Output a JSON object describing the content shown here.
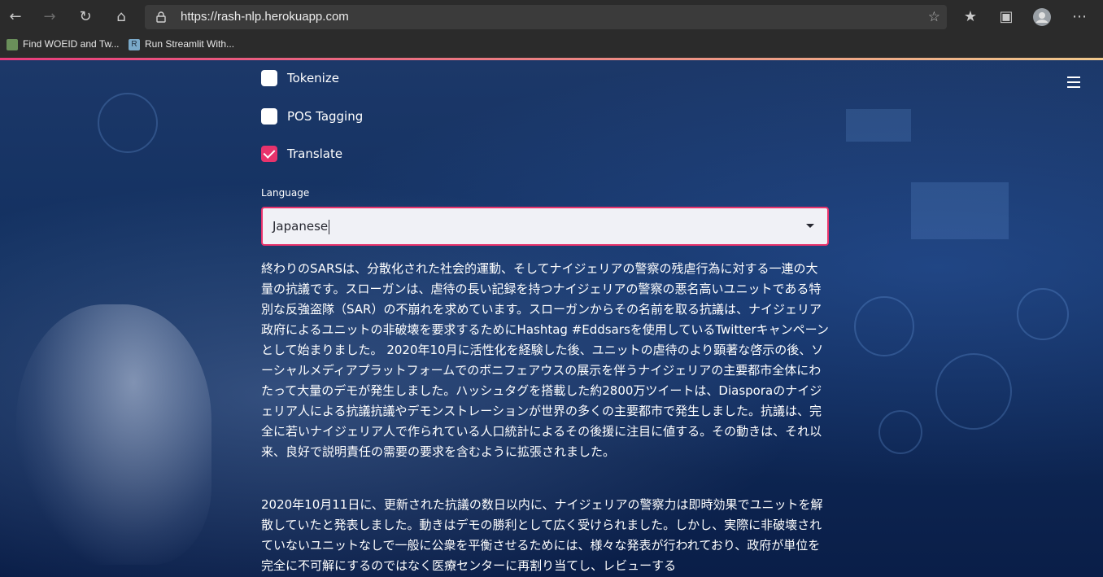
{
  "browser": {
    "url": "https://rash-nlp.herokuapp.com",
    "bookmarks": [
      {
        "label": "Find WOEID and Tw..."
      },
      {
        "label": "Run Streamlit With..."
      }
    ]
  },
  "options": {
    "checkboxes": [
      {
        "label": "Tokenize",
        "checked": false
      },
      {
        "label": "POS Tagging",
        "checked": false
      },
      {
        "label": "Translate",
        "checked": true
      }
    ]
  },
  "language": {
    "label": "Language",
    "selected": "Japanese"
  },
  "translation": {
    "paragraphs": [
      "終わりのSARSは、分散化された社会的運動、そしてナイジェリアの警察の残虐行為に対する一連の大量の抗議です。スローガンは、虐待の長い記録を持つナイジェリアの警察の悪名高いユニットである特別な反強盗隊（SAR）の不崩れを求めています。スローガンからその名前を取る抗議は、ナイジェリア政府によるユニットの非破壊を要求するためにHashtag #Eddsarsを使用しているTwitterキャンペーンとして始まりました。 2020年10月に活性化を経験した後、ユニットの虐待のより顕著な啓示の後、ソーシャルメディアプラットフォームでのボニフェアウスの展示を伴うナイジェリアの主要都市全体にわたって大量のデモが発生しました。ハッシュタグを搭載した約2800万ツイートは、Diasporaのナイジェリア人による抗議抗議やデモンストレーションが世界の多くの主要都市で発生しました。抗議は、完全に若いナイジェリア人で作られている人口統計によるその後援に注目に値する。その動きは、それ以来、良好で説明責任の需要の要求を含むように拡張されました。",
      "2020年10月11日に、更新された抗議の数日以内に、ナイジェリアの警察力は即時効果でユニットを解散していたと発表しました。動きはデモの勝利として広く受けられました。しかし、実際に非破壊されていないユニットなしで一般に公衆を平衡させるためには、様々な発表が行われており、政府が単位を完全に不可解にするのではなく医療センターに再割り当てし、レビューする"
    ]
  }
}
